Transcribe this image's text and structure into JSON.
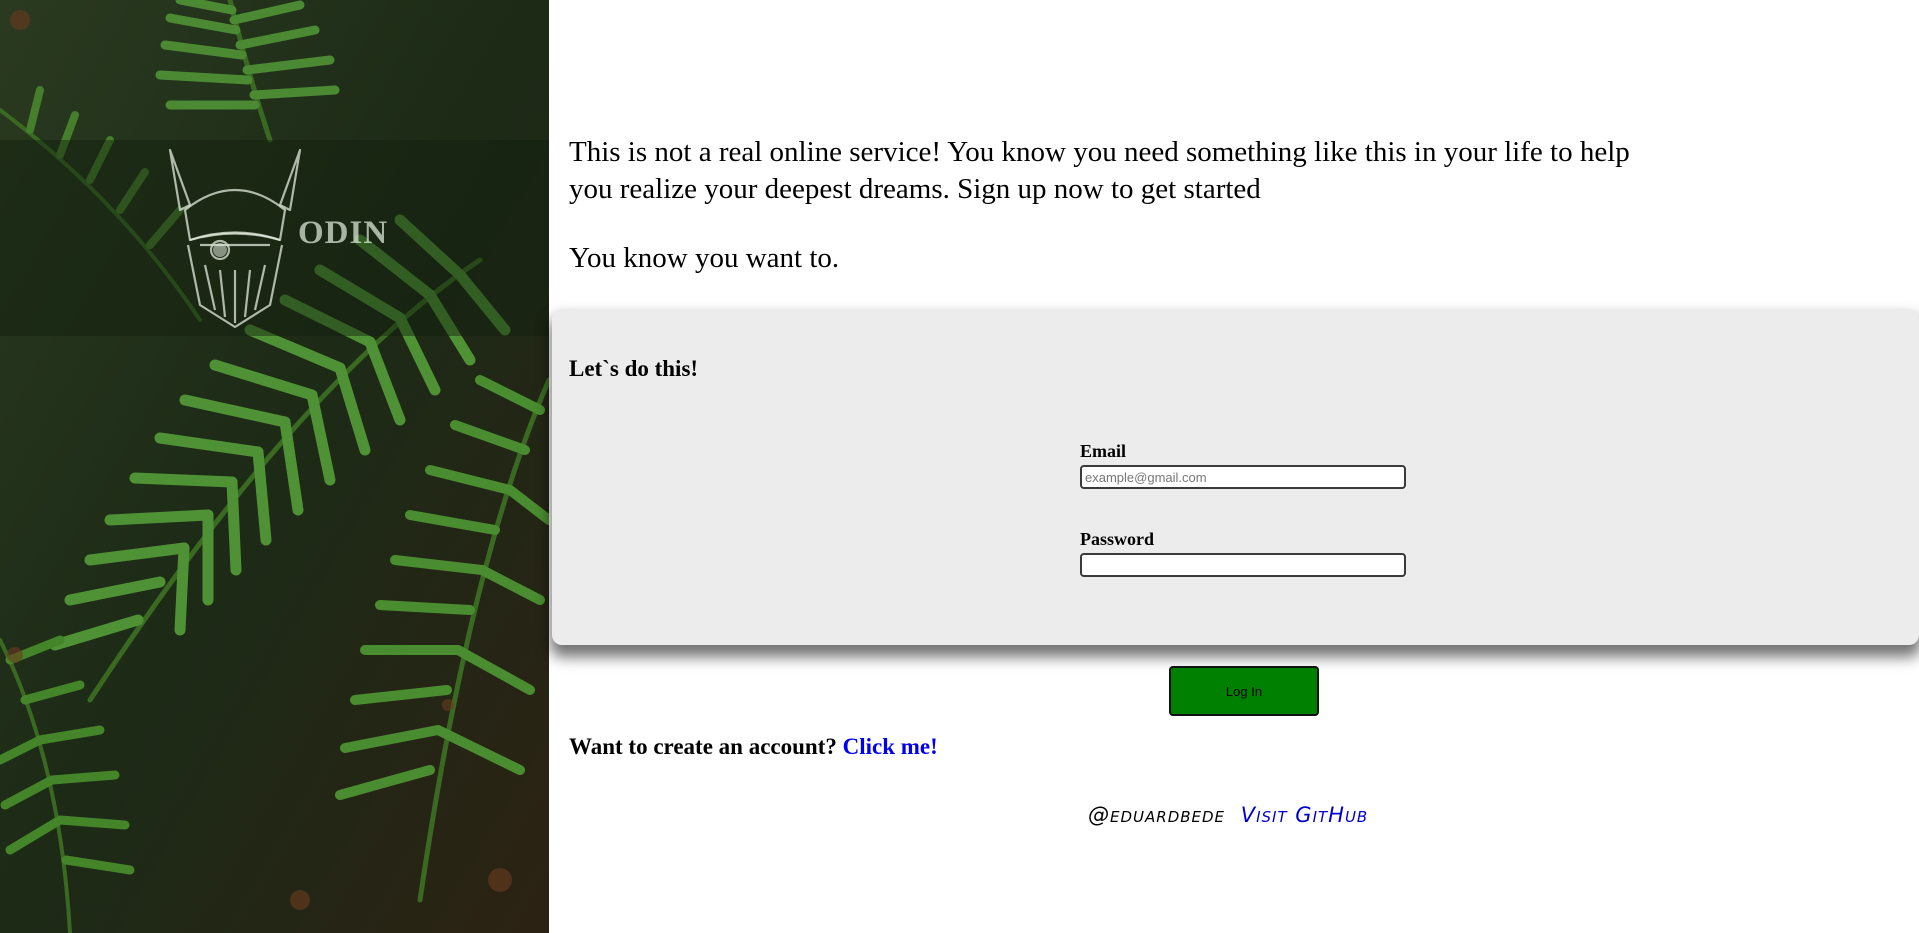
{
  "brand": {
    "name": "ODIN",
    "logo_icon": "viking-helmet-icon"
  },
  "side_panel": {
    "background": "fern-leaves-photo"
  },
  "intro": {
    "paragraph_1": "This is not a real online service! You know you need something like this in your life to help you realize your deepest dreams. Sign up now to get started",
    "paragraph_2": "You know you want to."
  },
  "form": {
    "title": "Let`s do this!",
    "email": {
      "label": "Email",
      "value": "",
      "placeholder": "example@gmail.com"
    },
    "password": {
      "label": "Password",
      "value": "",
      "placeholder": ""
    },
    "submit_label": "Log In"
  },
  "signup": {
    "prompt": "Want to create an account?",
    "link_label": "Click me!"
  },
  "footer": {
    "handle": "@eduardbede",
    "link_label": "Visit GitHub"
  },
  "colors": {
    "button_bg": "#008000",
    "link": "#0000ee",
    "card_bg": "#ececec"
  }
}
